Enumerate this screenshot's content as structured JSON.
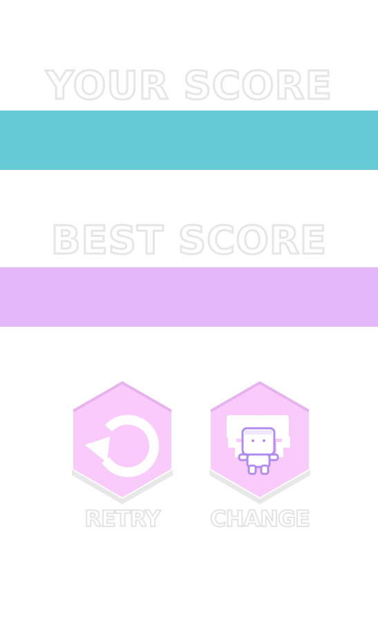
{
  "your_score": {
    "title": "YOUR SCORE",
    "value": "",
    "band_color": "#66cad6"
  },
  "best_score": {
    "title": "BEST SCORE",
    "value": "",
    "band_color": "#e4b8f8"
  },
  "buttons": {
    "retry": {
      "label": "RETRY",
      "icon": "retry-arrow-icon"
    },
    "change": {
      "label": "CHANGE",
      "icon": "character-icon"
    }
  },
  "colors": {
    "hex_fill": "#f9cbfb",
    "hex_top": "#eab2f0",
    "outline": "#e6e6e6",
    "character_outline": "#b08cf0"
  }
}
